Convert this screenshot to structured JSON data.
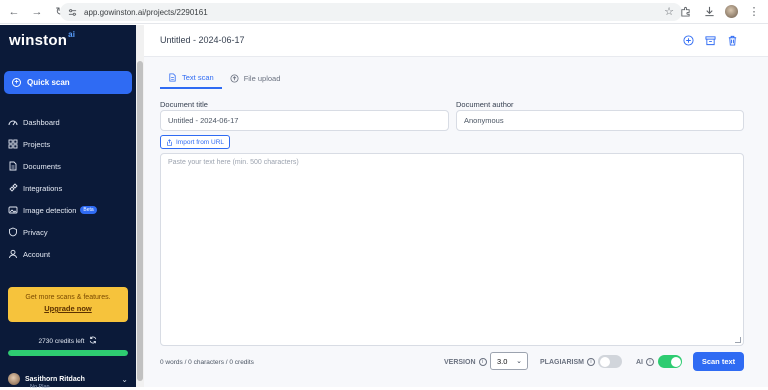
{
  "browser": {
    "url": "app.gowinston.ai/projects/2290161"
  },
  "sidebar": {
    "brand": "winston",
    "brand_suffix": "ai",
    "quick_scan": "Quick scan",
    "items": [
      {
        "label": "Dashboard",
        "icon": "dashboard-icon"
      },
      {
        "label": "Projects",
        "icon": "projects-icon"
      },
      {
        "label": "Documents",
        "icon": "documents-icon"
      },
      {
        "label": "Integrations",
        "icon": "integrations-icon"
      },
      {
        "label": "Image detection",
        "icon": "image-icon",
        "badge": "Beta"
      },
      {
        "label": "Privacy",
        "icon": "shield-icon"
      },
      {
        "label": "Account",
        "icon": "user-icon"
      }
    ],
    "promo": {
      "text": "Get more scans & features.",
      "cta": "Upgrade now"
    },
    "credits": "2730 credits left",
    "credit_level": 1.0,
    "user": {
      "name": "Sasithorn Ritdach",
      "plan": "No Plan"
    }
  },
  "header": {
    "title": "Untitled - 2024-06-17"
  },
  "tabs": [
    {
      "label": "Text scan",
      "active": true
    },
    {
      "label": "File upload",
      "active": false
    }
  ],
  "form": {
    "title_label": "Document title",
    "title_value": "Untitled - 2024-06-17",
    "author_label": "Document author",
    "author_value": "Anonymous",
    "import_label": "Import from URL",
    "text_placeholder": "Paste your text here (min. 500 characters)"
  },
  "footer": {
    "counts": "0 words / 0 characters / 0 credits",
    "version_label": "VERSION",
    "version_value": "3.0",
    "plagiarism_label": "PLAGIARISM",
    "plagiarism_on": false,
    "ai_label": "AI",
    "ai_on": true,
    "scan_label": "Scan text"
  },
  "colors": {
    "sidebar_bg": "#0b1a39",
    "accent": "#2f6bf3",
    "promo": "#f6c33c",
    "credit_bar": "#2ecc71",
    "toggle_on": "#2ecc71",
    "toggle_off": "#d1d5db"
  }
}
